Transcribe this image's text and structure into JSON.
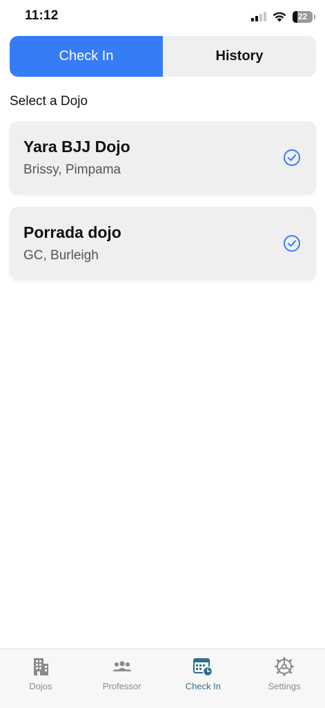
{
  "status_bar": {
    "time": "11:12",
    "battery": "22"
  },
  "segmented": {
    "check_in": "Check In",
    "history": "History"
  },
  "section_title": "Select a Dojo",
  "dojos": [
    {
      "name": "Yara BJJ Dojo",
      "location": "Brissy, Pimpama"
    },
    {
      "name": "Porrada dojo",
      "location": "GC, Burleigh"
    }
  ],
  "tabs": [
    {
      "label": "Dojos",
      "icon": "building-icon"
    },
    {
      "label": "Professor",
      "icon": "people-icon"
    },
    {
      "label": "Check In",
      "icon": "calendar-clock-icon"
    },
    {
      "label": "Settings",
      "icon": "gear-icon"
    }
  ],
  "colors": {
    "accent": "#357cf6",
    "tab_active": "#2f6f8c",
    "tab_inactive": "#8a8a8a",
    "card_bg": "#efefef"
  }
}
